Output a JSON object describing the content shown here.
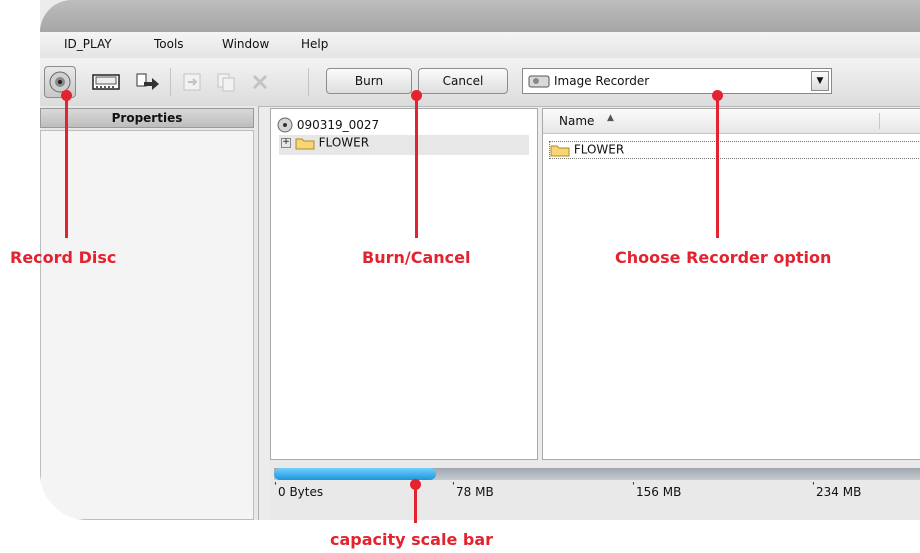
{
  "menu": [
    "ID_PLAY",
    "Tools",
    "Window",
    "Help"
  ],
  "toolbar": {
    "burn_label": "Burn",
    "cancel_label": "Cancel",
    "recorder_value": "Image Recorder",
    "icons": [
      "record-disc",
      "video",
      "convert",
      "add",
      "copy",
      "delete"
    ]
  },
  "left_panel": {
    "header": "Properties"
  },
  "tree": {
    "disc_label": "090319_0027",
    "folder_label": "FLOWER"
  },
  "list": {
    "column_name": "Name",
    "items": [
      "FLOWER"
    ]
  },
  "capacity": {
    "fill_fraction": 0.24,
    "ticks": [
      "0 Bytes",
      "78 MB",
      "156 MB",
      "234 MB"
    ]
  },
  "annotations": {
    "record_disc": "Record Disc",
    "burn_cancel": "Burn/Cancel",
    "choose_recorder": "Choose Recorder option",
    "capacity_bar": "capacity scale bar"
  },
  "colors": {
    "accent": "#e3232f",
    "progress": "#1c96d8"
  }
}
